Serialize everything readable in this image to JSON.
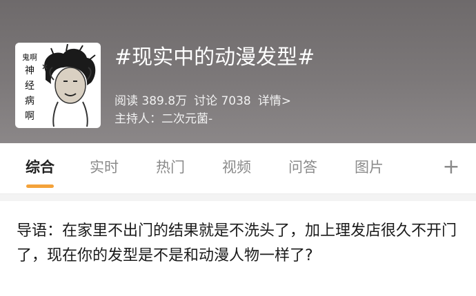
{
  "header": {
    "avatar_text_small": "鬼啊",
    "avatar_text": [
      "神",
      "经",
      "病",
      "啊"
    ],
    "title": "#现实中的动漫发型#",
    "stats": {
      "reads_label": "阅读 389.8万",
      "discuss_label": "讨论 7038",
      "detail_label": "详情>"
    },
    "host_label": "主持人：二次元菌-"
  },
  "tabs": [
    {
      "label": "综合"
    },
    {
      "label": "实时"
    },
    {
      "label": "热门"
    },
    {
      "label": "视频"
    },
    {
      "label": "问答"
    },
    {
      "label": "图片"
    }
  ],
  "add_tab_symbol": "+",
  "intro_text": "导语：在家里不出门的结果就是不洗头了，加上理发店很久不开门了，现在你的发型是不是和动漫人物一样了?",
  "colors": {
    "header_bg": "#7a7677",
    "active_tab_indicator": "#f4a23a"
  }
}
